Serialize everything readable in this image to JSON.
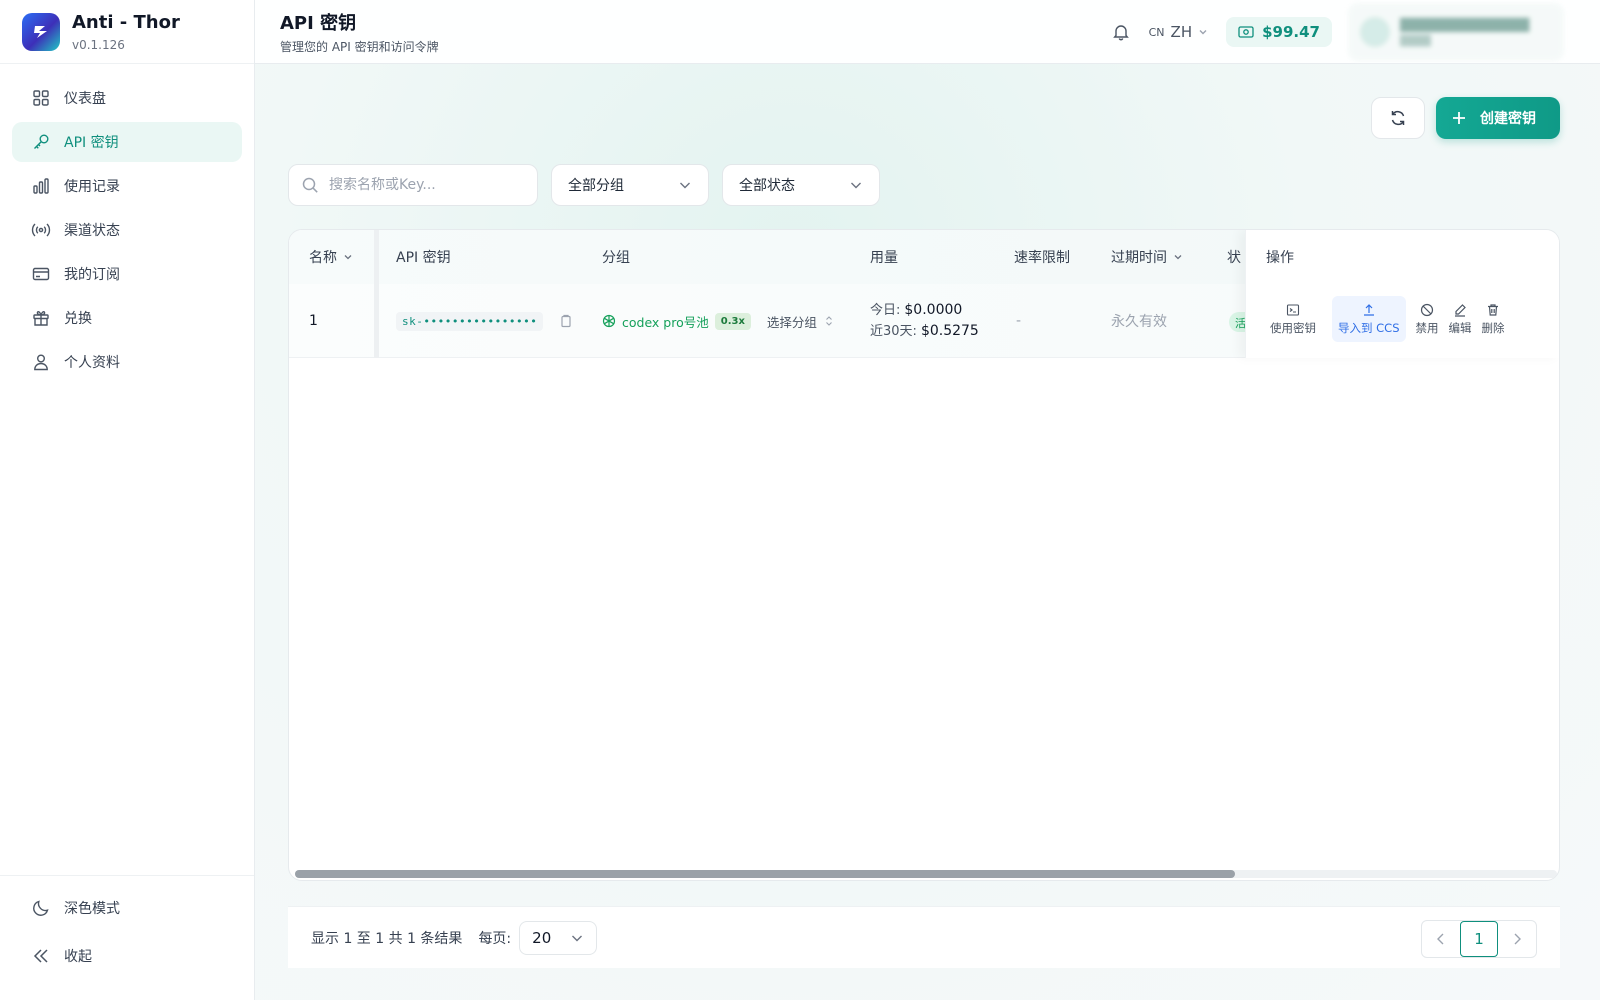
{
  "app": {
    "name": "Anti - Thor",
    "version": "v0.1.126"
  },
  "sidebar": {
    "items": [
      {
        "label": "仪表盘",
        "icon": "grid-icon"
      },
      {
        "label": "API 密钥",
        "icon": "key-icon",
        "active": true
      },
      {
        "label": "使用记录",
        "icon": "bar-chart-icon"
      },
      {
        "label": "渠道状态",
        "icon": "broadcast-icon"
      },
      {
        "label": "我的订阅",
        "icon": "credit-card-icon"
      },
      {
        "label": "兑换",
        "icon": "gift-icon"
      },
      {
        "label": "个人资料",
        "icon": "user-icon"
      }
    ],
    "bottom": [
      {
        "label": "深色模式",
        "icon": "moon-icon"
      },
      {
        "label": "收起",
        "icon": "double-chevron-left-icon"
      }
    ]
  },
  "header": {
    "title": "API 密钥",
    "subtitle": "管理您的 API 密钥和访问令牌",
    "lang_prefix": "CN",
    "lang": "ZH",
    "balance": "$99.47"
  },
  "toolbar": {
    "create_label": "创建密钥"
  },
  "filters": {
    "search_placeholder": "搜索名称或Key...",
    "group_value": "全部分组",
    "status_value": "全部状态"
  },
  "table": {
    "columns": {
      "name": "名称",
      "key": "API 密钥",
      "group": "分组",
      "usage": "用量",
      "rate": "速率限制",
      "expiry": "过期时间",
      "status": "状",
      "actions": "操作"
    },
    "rows": [
      {
        "name": "1",
        "key": "sk-••••••••••••••••",
        "group": "codex pro号池",
        "ratio": "0.3x",
        "choose_group": "选择分组",
        "usage_today_label": "今日:",
        "usage_today": "$0.0000",
        "usage_30d_label": "近30天:",
        "usage_30d": "$0.5275",
        "rate": "-",
        "expiry": "永久有效",
        "status_peek": "活"
      }
    ],
    "actions": {
      "use": "使用密钥",
      "import": "导入到 CCS",
      "disable": "禁用",
      "edit": "编辑",
      "delete": "删除"
    }
  },
  "pagination": {
    "summary": "显示 1 至 1 共 1 条结果",
    "per_page_label": "每页:",
    "per_page": "20",
    "current_page": "1"
  },
  "colors": {
    "accent": "#0f9a87",
    "active_bg": "#eaf7f4",
    "link_blue": "#2f6ee6"
  }
}
